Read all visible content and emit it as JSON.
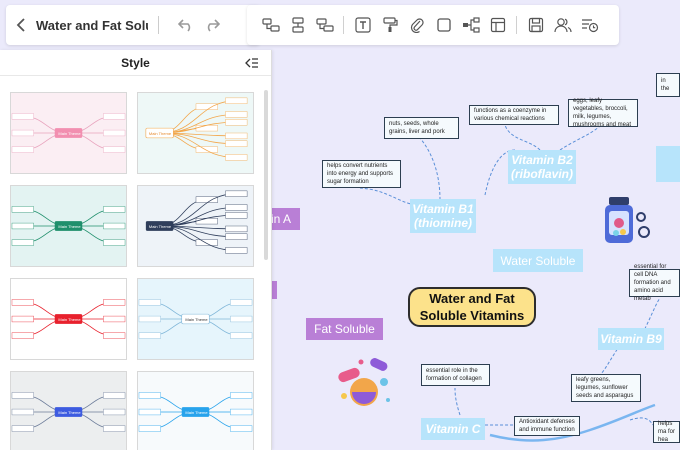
{
  "app": {
    "document_title": "Water and Fat Solu..."
  },
  "toolbar": {
    "icons": [
      "topic-icon",
      "subtopic-icon",
      "floating-topic-icon",
      "text-icon",
      "format-painter-icon",
      "attachment-icon",
      "shape-icon",
      "relationship-icon",
      "layout-icon",
      "save-icon",
      "collaborators-icon",
      "history-icon"
    ]
  },
  "style_panel": {
    "title": "Style",
    "thumbnails": [
      {
        "theme": "pink-floral",
        "center_label": "Main Theme"
      },
      {
        "theme": "teal-organic",
        "center_label": "Main Theme"
      },
      {
        "theme": "green-teal",
        "center_label": "Main Theme"
      },
      {
        "theme": "navy-floral",
        "center_label": "Main Theme"
      },
      {
        "theme": "red",
        "center_label": "Main Theme"
      },
      {
        "theme": "sky-blue",
        "center_label": "Main Theme"
      },
      {
        "theme": "grey-blue",
        "center_label": "Main Theme"
      },
      {
        "theme": "light-blue",
        "center_label": "Main Theme"
      }
    ]
  },
  "mindmap": {
    "center": "Water and Fat Soluble Vitamins",
    "fat_soluble": "Fat Soluble",
    "water_soluble": "Water Soluble",
    "vitamin_a_partial": "in A",
    "vitamin_b1": "Vitamin B1 (thiomine)",
    "vitamin_b2": "Vitamin B2 (riboflavin)",
    "vitamin_b9": "Vitamin B9",
    "vitamin_c": "Vitamin C",
    "leaves": {
      "b1_function": "helps convert nutrients into energy and supports sugar formation",
      "b1_sources": "nuts, seeds, whole grains, liver and pork",
      "b2_function": "functions as a coenzyme in various chemical reactions",
      "b2_sources": "eggs, leafy vegetables, broccoli, milk, legumes, mushrooms and meat",
      "b9_function": "essential for cell DNA formation and amino acid metab",
      "b9_sources": "leafy greens, legumes, sunflower seeds and asparagus",
      "c_role": "essential role in the formation of collagen",
      "c_defense": "Antioxidant defenses and immune function",
      "c_right": "helps ma\nfor hea",
      "top_right": "in the"
    }
  },
  "colors": {
    "canvas_bg": "#ebeafb",
    "center_fill": "#fce28b",
    "purple_topic": "#b97fd6",
    "blue_topic": "#b7e4fb",
    "link": "#5a8fd8"
  }
}
